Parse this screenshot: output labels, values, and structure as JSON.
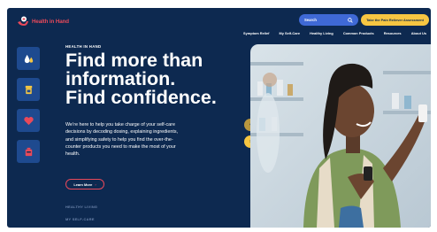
{
  "header": {
    "logo_text": "Health in Hand",
    "search_label": "Search",
    "cta_label": "Take the Pain Reliever Assessment"
  },
  "nav": {
    "items": [
      {
        "label": "Symptom Relief"
      },
      {
        "label": "My Self-Care"
      },
      {
        "label": "Healthy Living"
      },
      {
        "label": "Common Products"
      },
      {
        "label": "Resources"
      },
      {
        "label": "About Us"
      }
    ]
  },
  "side_icons": [
    "drop-icon",
    "pill-bottle-icon",
    "heart-icon",
    "medicine-box-icon"
  ],
  "hero": {
    "eyebrow": "HEALTH IN HAND",
    "headline_line1": "Find more than",
    "headline_line2": "information.",
    "headline_line3": "Find confidence.",
    "body": "We’re here to help you take charge of your self-care decisions by decoding dosing, explaining ingredients, and simplifying safety to help you find the over-the-counter products you need to make the most of your health.",
    "learn_more": "Learn More",
    "tags": [
      "HEALTHY LIVING",
      "MY SELF-CARE"
    ]
  },
  "carousel": {
    "prev_icon": "chevron-left-icon",
    "next_icon": "chevron-right-icon"
  },
  "colors": {
    "background": "#0d2950",
    "accent_red": "#e8495a",
    "accent_yellow": "#f6c642",
    "search_blue": "#3f69d6",
    "icon_tile": "#1e4a8f"
  }
}
